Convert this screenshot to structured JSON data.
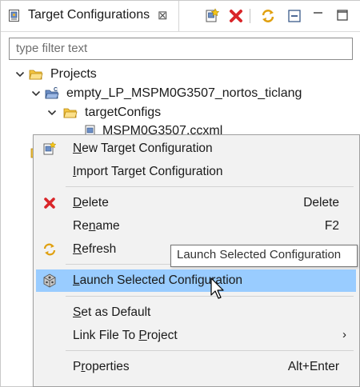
{
  "view": {
    "title": "Target Configurations",
    "close_glyph": "⊠"
  },
  "toolbar": {
    "buttons": [
      {
        "name": "new-config-button",
        "icon": "new-target-config-icon"
      },
      {
        "name": "delete-button",
        "icon": "red-x-delete-icon"
      },
      {
        "name": "refresh-button",
        "icon": "refresh-arrows-icon"
      },
      {
        "name": "collapse-all-button",
        "icon": "collapse-all-icon"
      },
      {
        "name": "minimize-button",
        "icon": "minimize-icon"
      },
      {
        "name": "maximize-button",
        "icon": "maximize-icon"
      }
    ]
  },
  "filter": {
    "placeholder": "type filter text",
    "value": ""
  },
  "tree": {
    "projects_label": "Projects",
    "project_label": "empty_LP_MSPM0G3507_nortos_ticlang",
    "folder_label": "targetConfigs",
    "file_label": "MSPM0G3507.ccxml"
  },
  "context_menu": {
    "new_config": {
      "label_mnemonic": "N",
      "label_rest": "ew Target Configuration"
    },
    "import_config": {
      "label_mnemonic": "I",
      "label_rest": "mport Target Configuration"
    },
    "delete": {
      "label_mnemonic": "D",
      "label_rest": "elete",
      "shortcut": "Delete"
    },
    "rename": {
      "label_pre": "Re",
      "label_mnemonic": "n",
      "label_rest": "ame",
      "shortcut": "F2"
    },
    "refresh": {
      "label_mnemonic": "R",
      "label_rest": "efresh"
    },
    "launch": {
      "label_mnemonic": "L",
      "label_rest": "aunch Selected Configuration"
    },
    "set_default": {
      "label_mnemonic": "S",
      "label_rest": "et as Default"
    },
    "link_file": {
      "label_pre": "Link File To ",
      "label_mnemonic": "P",
      "label_rest": "roject",
      "arrow": "›"
    },
    "properties": {
      "label_pre": "P",
      "label_mnemonic": "r",
      "label_rest": "operties",
      "shortcut": "Alt+Enter"
    }
  },
  "tooltip": {
    "text": "Launch Selected Configuration"
  },
  "colors": {
    "highlight": "#99ccff",
    "menu_bg": "#f2f2f2",
    "delete_red": "#d9262a"
  }
}
